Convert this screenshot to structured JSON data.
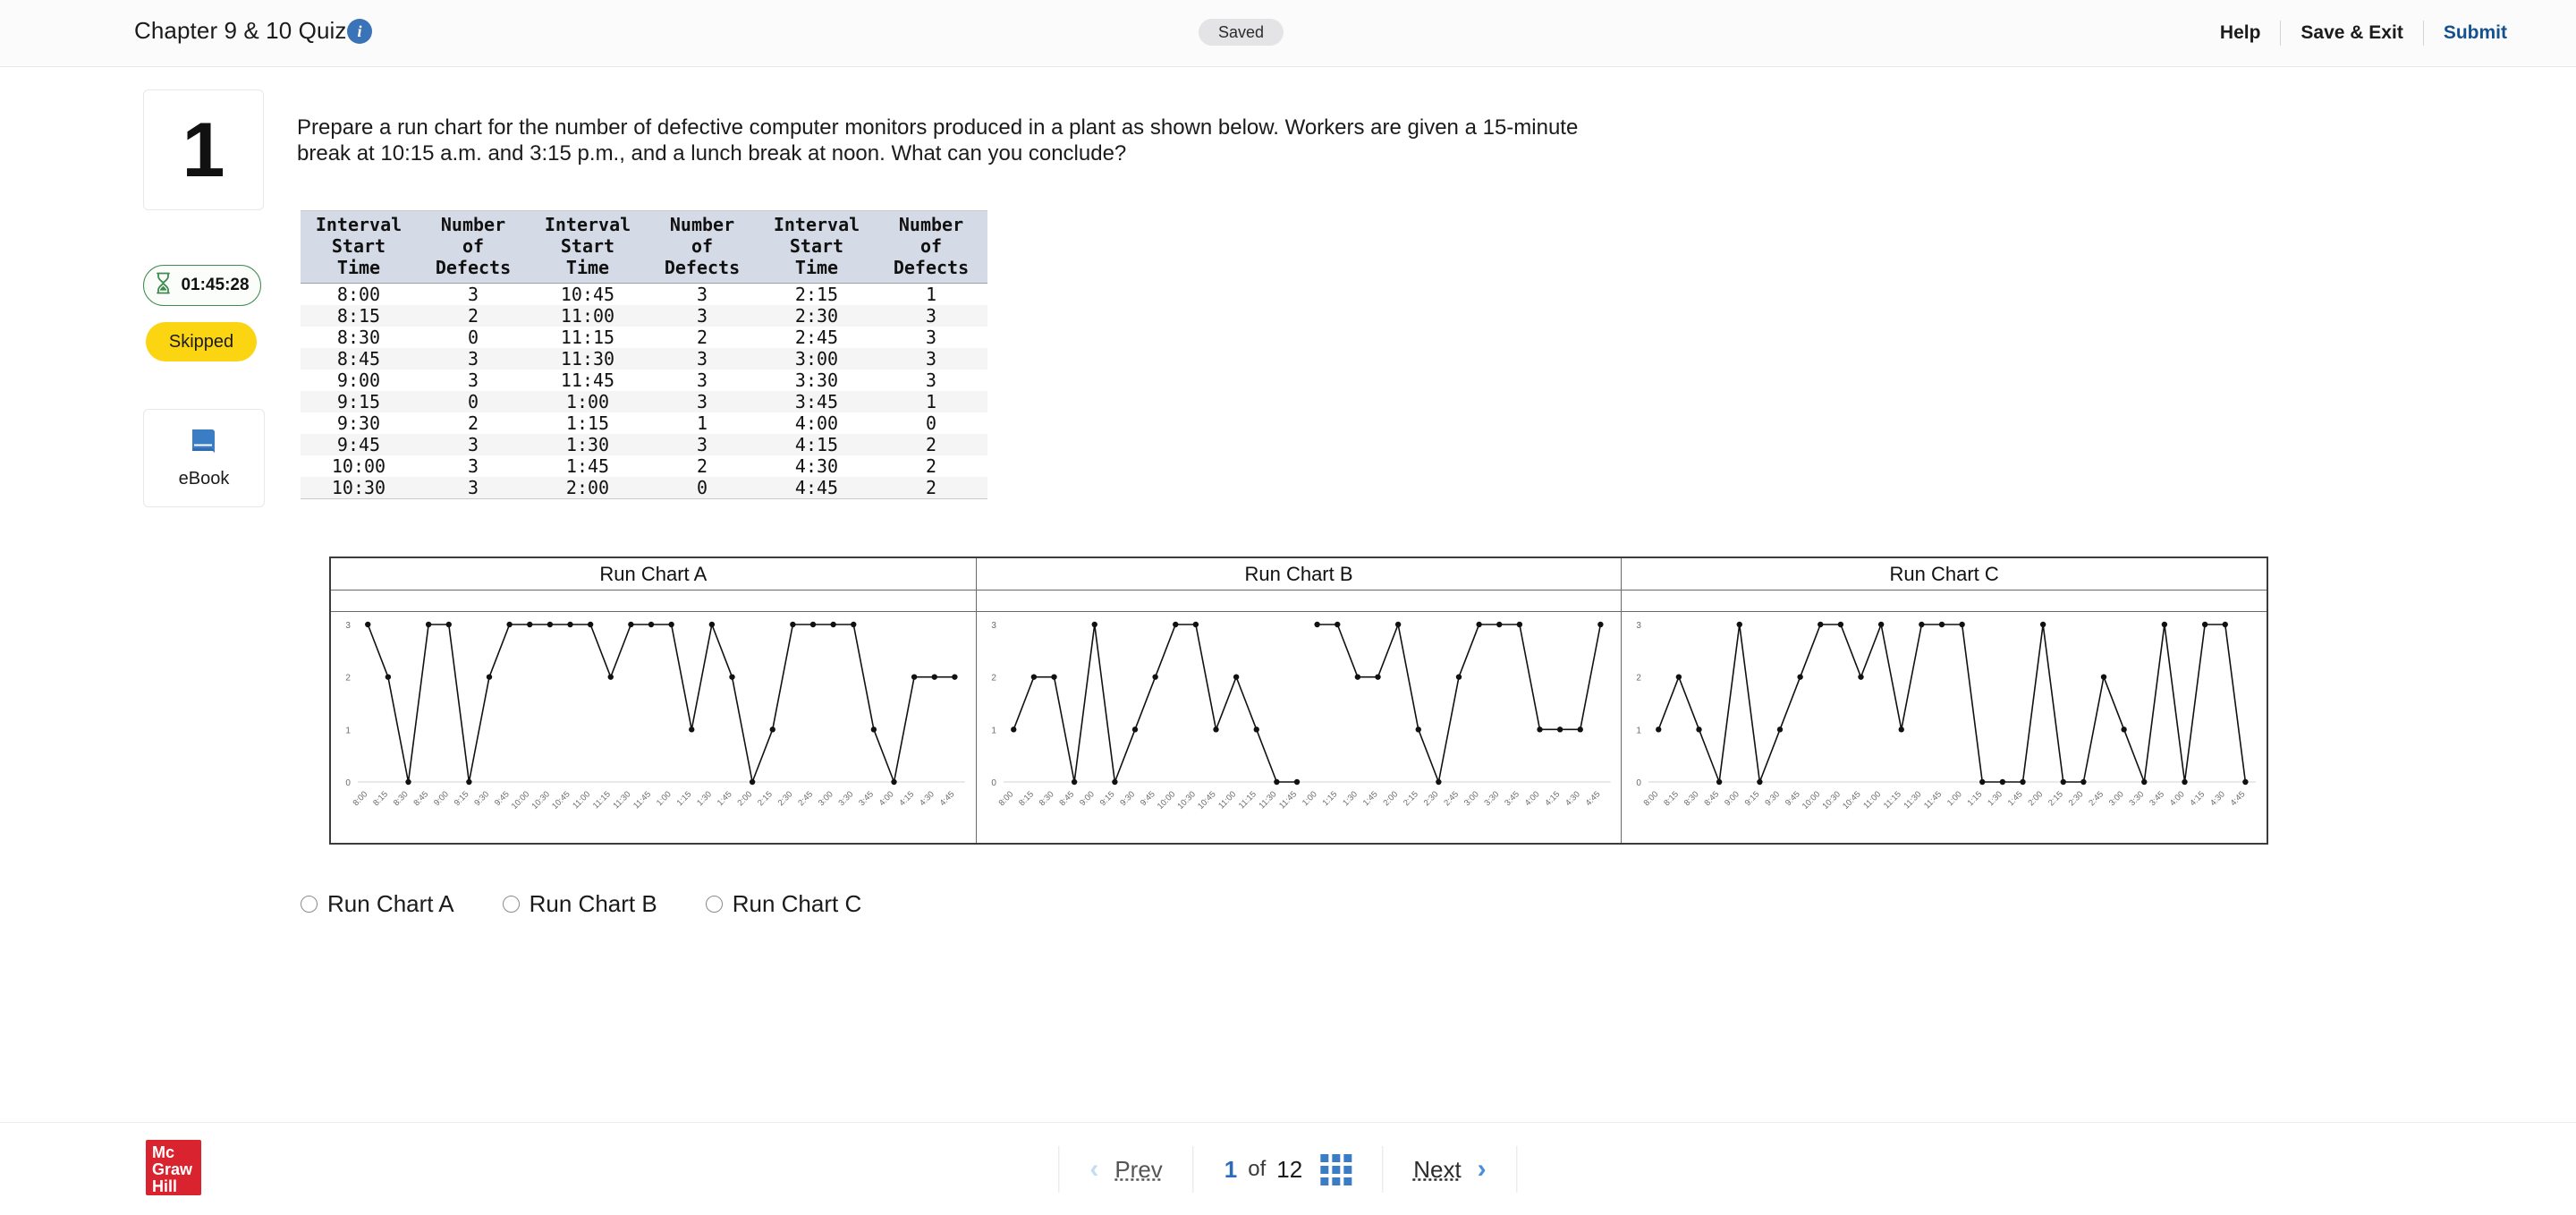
{
  "header": {
    "title": "Chapter 9 & 10 Quiz",
    "info_icon": "info-icon",
    "status_pill": "Saved",
    "help_label": "Help",
    "save_exit_label": "Save & Exit",
    "submit_label": "Submit",
    "submit_color": "#15518f"
  },
  "sidebar": {
    "question_number": "1",
    "timer": "01:45:28",
    "timer_icon": "hourglass-icon",
    "timer_color": "#3f8a4e",
    "status_badge": "Skipped",
    "status_badge_color": "#fbd412",
    "ebook_label": "eBook",
    "ebook_icon": "book-icon"
  },
  "question": {
    "text": "Prepare a run chart for the number of defective computer monitors produced in a plant as shown below. Workers are given a 15-minute break at 10:15 a.m. and 3:15 p.m., and a lunch break at noon. What can you conclude?"
  },
  "data_table": {
    "headers": [
      "Interval Start Time",
      "Number of Defects",
      "Interval Start Time",
      "Number of Defects",
      "Interval Start Time",
      "Number of Defects"
    ],
    "header_lines": [
      [
        "Interval",
        "Start",
        "Time"
      ],
      [
        "Number",
        "of",
        "Defects"
      ],
      [
        "Interval",
        "Start",
        "Time"
      ],
      [
        "Number",
        "of",
        "Defects"
      ],
      [
        "Interval",
        "Start",
        "Time"
      ],
      [
        "Number",
        "of",
        "Defects"
      ]
    ],
    "rows": [
      [
        "8:00",
        "3",
        "10:45",
        "3",
        "2:15",
        "1"
      ],
      [
        "8:15",
        "2",
        "11:00",
        "3",
        "2:30",
        "3"
      ],
      [
        "8:30",
        "0",
        "11:15",
        "2",
        "2:45",
        "3"
      ],
      [
        "8:45",
        "3",
        "11:30",
        "3",
        "3:00",
        "3"
      ],
      [
        "9:00",
        "3",
        "11:45",
        "3",
        "3:30",
        "3"
      ],
      [
        "9:15",
        "0",
        "1:00",
        "3",
        "3:45",
        "1"
      ],
      [
        "9:30",
        "2",
        "1:15",
        "1",
        "4:00",
        "0"
      ],
      [
        "9:45",
        "3",
        "1:30",
        "3",
        "4:15",
        "2"
      ],
      [
        "10:00",
        "3",
        "1:45",
        "2",
        "4:30",
        "2"
      ],
      [
        "10:30",
        "3",
        "2:00",
        "0",
        "4:45",
        "2"
      ]
    ]
  },
  "chart_data": [
    {
      "type": "line",
      "title": "Run Chart A",
      "xlabel": "",
      "ylabel": "",
      "ylim": [
        0,
        3
      ],
      "yticks": [
        0,
        1,
        2,
        3
      ],
      "grid": false,
      "legend": "none",
      "categories": [
        "8:00",
        "8:15",
        "8:30",
        "8:45",
        "9:00",
        "9:15",
        "9:30",
        "9:45",
        "10:00",
        "10:30",
        "10:45",
        "11:00",
        "11:15",
        "11:30",
        "11:45",
        "1:00",
        "1:15",
        "1:30",
        "1:45",
        "2:00",
        "2:15",
        "2:30",
        "2:45",
        "3:00",
        "3:30",
        "3:45",
        "4:00",
        "4:15",
        "4:30",
        "4:45"
      ],
      "values": [
        3,
        2,
        0,
        3,
        3,
        0,
        2,
        3,
        3,
        3,
        3,
        3,
        2,
        3,
        3,
        3,
        1,
        3,
        2,
        0,
        1,
        3,
        3,
        3,
        3,
        1,
        0,
        2,
        2,
        2
      ],
      "breaks": []
    },
    {
      "type": "line",
      "title": "Run Chart B",
      "xlabel": "",
      "ylabel": "",
      "ylim": [
        0,
        3
      ],
      "yticks": [
        0,
        1,
        2,
        3
      ],
      "grid": false,
      "legend": "none",
      "categories": [
        "8:00",
        "8:15",
        "8:30",
        "8:45",
        "9:00",
        "9:15",
        "9:30",
        "9:45",
        "10:00",
        "10:30",
        "10:45",
        "11:00",
        "11:15",
        "11:30",
        "11:45",
        "1:00",
        "1:15",
        "1:30",
        "1:45",
        "2:00",
        "2:15",
        "2:30",
        "2:45",
        "3:00",
        "3:30",
        "3:45",
        "4:00",
        "4:15",
        "4:30",
        "4:45"
      ],
      "values": [
        1,
        2,
        2,
        0,
        3,
        0,
        1,
        2,
        3,
        3,
        1,
        2,
        1,
        0,
        0,
        3,
        3,
        2,
        2,
        3,
        1,
        0,
        2,
        3,
        3,
        3,
        1,
        1,
        1,
        3
      ],
      "breaks": [
        14
      ]
    },
    {
      "type": "line",
      "title": "Run Chart C",
      "xlabel": "",
      "ylabel": "",
      "ylim": [
        0,
        3
      ],
      "yticks": [
        0,
        1,
        2,
        3
      ],
      "grid": false,
      "legend": "none",
      "categories": [
        "8:00",
        "8:15",
        "8:30",
        "8:45",
        "9:00",
        "9:15",
        "9:30",
        "9:45",
        "10:00",
        "10:30",
        "10:45",
        "11:00",
        "11:15",
        "11:30",
        "11:45",
        "1:00",
        "1:15",
        "1:30",
        "1:45",
        "2:00",
        "2:15",
        "2:30",
        "2:45",
        "3:00",
        "3:30",
        "3:45",
        "4:00",
        "4:15",
        "4:30",
        "4:45"
      ],
      "values": [
        1,
        2,
        1,
        0,
        3,
        0,
        1,
        2,
        3,
        3,
        2,
        3,
        1,
        3,
        3,
        3,
        0,
        0,
        0,
        3,
        0,
        0,
        2,
        1,
        0,
        3,
        0,
        3,
        3,
        0
      ],
      "breaks": []
    }
  ],
  "answers": {
    "options": [
      {
        "label": "Run Chart A",
        "selected": false
      },
      {
        "label": "Run Chart B",
        "selected": false
      },
      {
        "label": "Run Chart C",
        "selected": false
      }
    ]
  },
  "footer": {
    "logo_lines": [
      "Mc",
      "Graw",
      "Hill"
    ],
    "logo_color": "#d9232e",
    "prev_label": "Prev",
    "next_label": "Next",
    "current_page": "1",
    "of_label": "of",
    "total_pages": "12",
    "grid_icon": "grid-icon",
    "prev_chevron_icon": "chevron-left-icon",
    "next_chevron_icon": "chevron-right-icon"
  }
}
